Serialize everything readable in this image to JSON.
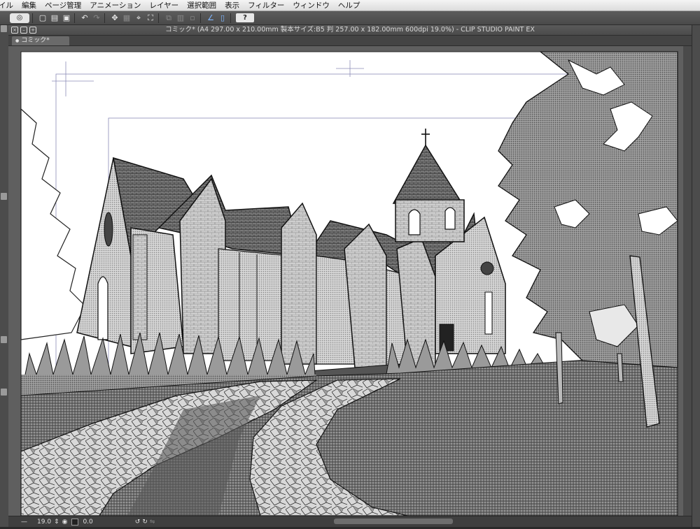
{
  "menu": [
    "イル",
    "編集",
    "ページ管理",
    "アニメーション",
    "レイヤー",
    "選択範囲",
    "表示",
    "フィルター",
    "ウィンドウ",
    "ヘルプ"
  ],
  "toolbar": {
    "logo_icon": "clip-studio-logo-icon",
    "help_label": "?",
    "icons": [
      "new-file-icon",
      "open-file-icon",
      "save-icon",
      "undo-icon",
      "redo-icon",
      "transform-icon",
      "erase-selection-icon",
      "fill-icon",
      "cut-icon",
      "copy-icon",
      "paste-icon",
      "snap-ruler-icon",
      "snap-grid-icon",
      "help-icon"
    ]
  },
  "window": {
    "title": "コミック* (A4 297.00 x 210.00mm 製本サイズ:B5 判 257.00 x 182.00mm 600dpi 19.0%)  - CLIP STUDIO PAINT EX",
    "tab_label": "コミック*"
  },
  "status": {
    "zoom": "19.0",
    "angle": "0.0"
  },
  "colors": {
    "menubar_bg": "#e6e6e6",
    "chrome_dark": "#4a4a4a",
    "canvas_bg": "#ffffff"
  }
}
